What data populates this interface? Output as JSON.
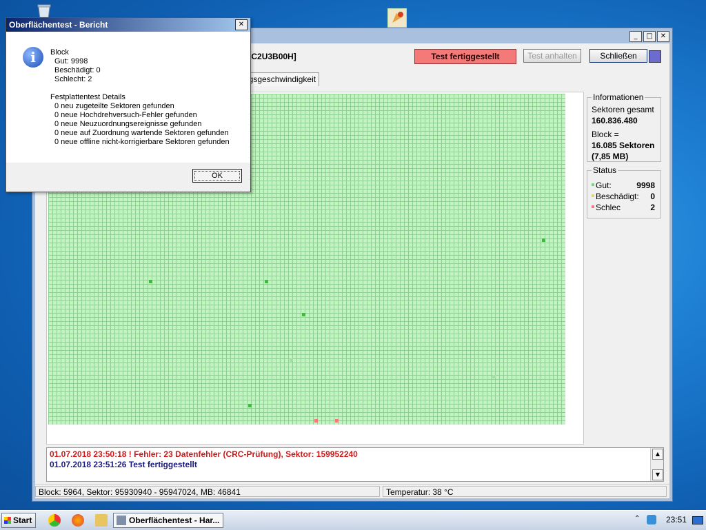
{
  "desktop": {
    "icons": [
      "recycle-bin",
      "program-shortcut"
    ]
  },
  "main_window": {
    "device_name": "20EC2U3B00H]",
    "status_banner": "Test fertiggestellt",
    "buttons": {
      "pause": "Test anhalten",
      "close": "Schließen"
    },
    "tab_label": "ngsgeschwindigkeit",
    "info": {
      "caption": "Informationen",
      "sectors_label": "Sektoren gesamt",
      "sectors_value": "160.836.480",
      "block_label": "Block =",
      "block_value": "16.085 Sektoren",
      "block_size": "(7,85 MB)"
    },
    "status": {
      "caption": "Status",
      "rows": [
        {
          "label": "Gut:",
          "value": "9998",
          "color": "#7ad67a"
        },
        {
          "label": "Beschädigt:",
          "value": "0",
          "color": "#e6d080"
        },
        {
          "label": "Schlec",
          "value": "2",
          "color": "#f27a7a"
        }
      ]
    },
    "log": [
      {
        "text": "01.07.2018  23:50:18 ! Fehler: 23 Datenfehler (CRC-Prüfung), Sektor: 159952240",
        "color": "#d01818"
      },
      {
        "text": "01.07.2018  23:51:26  Test fertiggestellt",
        "color": "#1a1a80"
      }
    ],
    "statusbar": {
      "left": "Block: 5964, Sektor: 95930940 - 95947024, MB: 46841",
      "right": "Temperatur: 38  °C"
    },
    "grid_colors": {
      "good": "#c6f0c6",
      "marked": "#49b549",
      "bad": "#f27a7a"
    }
  },
  "dialog": {
    "title": "Oberflächentest - Bericht",
    "block_heading": "Block",
    "good": "Gut: 9998",
    "damaged": "Beschädigt: 0",
    "bad": "Schlecht: 2",
    "details_heading": "Festplattentest Details",
    "details": [
      "0 neu zugeteilte Sektoren gefunden",
      "0 neue Hochdrehversuch-Fehler gefunden",
      "0 neue Neuzuordnungsereignisse gefunden",
      "0 neue auf Zuordnung wartende Sektoren gefunden",
      "0 neue offline nicht-korrigierbare Sektoren gefunden"
    ],
    "ok": "OK"
  },
  "taskbar": {
    "start": "Start",
    "task_label": "Oberflächentest - Har...",
    "clock": "23:51"
  }
}
